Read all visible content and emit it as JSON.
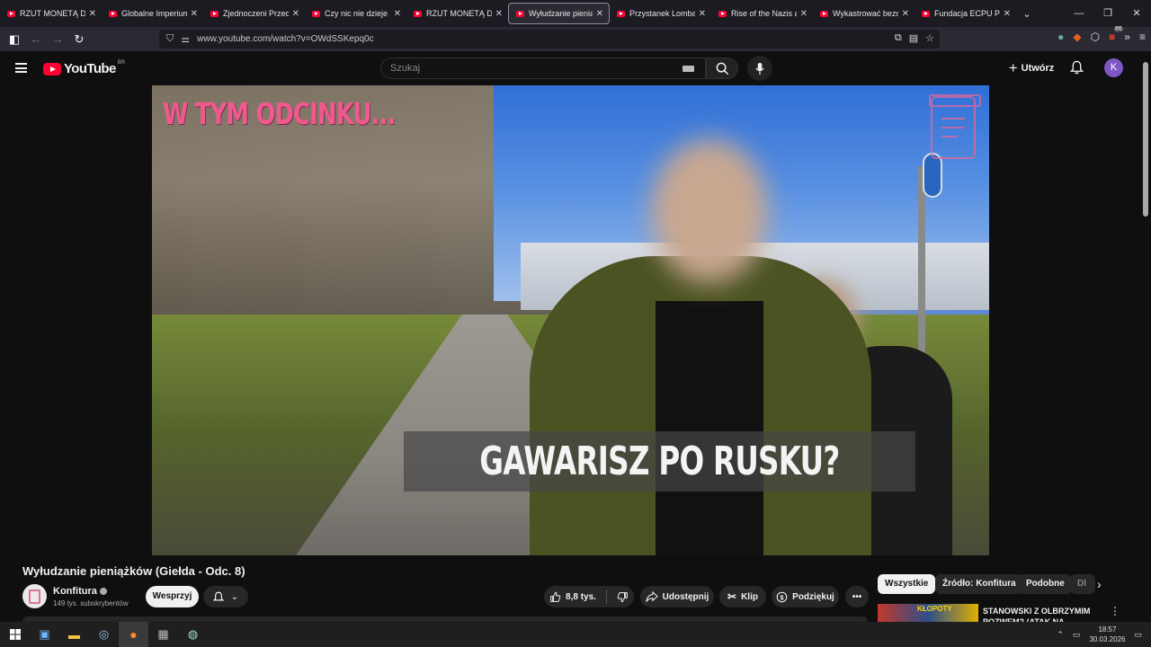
{
  "browser": {
    "tabs": [
      {
        "label": "RZUT MONETĄ DECY",
        "active": false
      },
      {
        "label": "Globalne Imperium B",
        "active": false
      },
      {
        "label": "Zjednoczeni Przeciw",
        "active": false
      },
      {
        "label": "Czy nic nie dzieje się",
        "active": false
      },
      {
        "label": "RZUT MONETĄ DECY",
        "active": false
      },
      {
        "label": "Wyłudzanie pieniąż",
        "active": true
      },
      {
        "label": "Przystanek Lombard",
        "active": false
      },
      {
        "label": "Rise of the Nazis and",
        "active": false
      },
      {
        "label": "Wykastrować bezdom",
        "active": false
      },
      {
        "label": "Fundacja ECPU Polsk",
        "active": false
      }
    ],
    "url": "www.youtube.com/watch?v=OWdSSKepq0c",
    "extension_badge": "86"
  },
  "youtube": {
    "logo_text": "YouTube",
    "country_code": "BR",
    "search_placeholder": "Szukaj",
    "create_label": "Utwórz",
    "avatar_letter": "K"
  },
  "video": {
    "overlay_title": "W TYM ODCINKU...",
    "overlay_caption": "GAWARISZ PO RUSKU?",
    "title": "Wyłudzanie pieniążków (Giełda - Odc. 8)",
    "channel": "Konfitura",
    "subscribers": "149 tys. subskrybentów",
    "support_label": "Wesprzyj",
    "likes": "8,8 tys.",
    "share_label": "Udostępnij",
    "clip_label": "Klip",
    "thanks_label": "Podziękuj"
  },
  "chips": [
    "Wszystkie",
    "Źródło: Konfitura",
    "Podobne",
    "Dl"
  ],
  "recommendation": {
    "thumb_text": "KŁOPOTY",
    "title": "STANOWSKI Z OLBRZYMIM POZWEM? (ATAK NA"
  },
  "taskbar": {
    "time": "18:57",
    "date": "30.03.2026"
  },
  "colors": {
    "youtube_red": "#ff0033",
    "overlay_pink": "#ef5a8e",
    "avatar_purple": "#7e57c2"
  }
}
